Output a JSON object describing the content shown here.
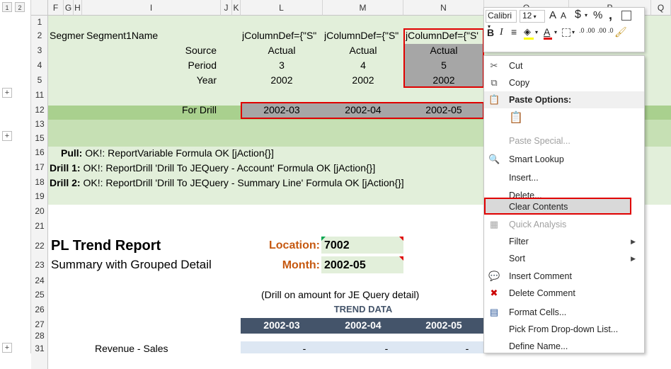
{
  "outline_levels": [
    "1",
    "2"
  ],
  "columns": [
    "F",
    "G",
    "H",
    "I",
    "J",
    "K",
    "L",
    "M",
    "N",
    "O",
    "P",
    "Q"
  ],
  "rows": [
    "1",
    "2",
    "3",
    "4",
    "5",
    "11",
    "12",
    "13",
    "15",
    "16",
    "17",
    "18",
    "19",
    "20",
    "21",
    "22",
    "23",
    "24",
    "25",
    "26",
    "27",
    "28",
    "31"
  ],
  "header_rows": {
    "r2": {
      "f": "Segmer",
      "g": "Segment1Name",
      "l": "jColumnDef={\"S\"",
      "m": "jColumnDef={\"S\"",
      "n": "jColumnDef={\"S'"
    },
    "r3": {
      "label": "Source",
      "l": "Actual",
      "m": "Actual",
      "n": "Actual"
    },
    "r4": {
      "label": "Period",
      "l": "3",
      "m": "4",
      "n": "5"
    },
    "r5": {
      "label": "Year",
      "l": "2002",
      "m": "2002",
      "n": "2002"
    },
    "r12": {
      "label": "For Drill",
      "l": "2002-03",
      "m": "2002-04",
      "n": "2002-05"
    }
  },
  "action_rows": [
    {
      "bold": "Pull:",
      "text": " OK!: ReportVariable Formula OK [jAction{}]"
    },
    {
      "bold": "Drill 1:",
      "text": " OK!: ReportDrill 'Drill To JEQuery - Account' Formula OK [jAction{}]"
    },
    {
      "bold": "Drill 2:",
      "text": " OK!: ReportDrill 'Drill To JEQuery - Summary Line' Formula OK [jAction{}]"
    }
  ],
  "report": {
    "title": "PL Trend Report",
    "subtitle": "Summary with Grouped Detail",
    "location_label": "Location:",
    "location_value": "7002",
    "month_label": "Month:",
    "month_value": "2002-05",
    "drill_note": "(Drill on amount for JE Query detail)",
    "trend_label": "TREND DATA",
    "trend_cols": [
      "2002-03",
      "2002-04",
      "2002-05"
    ],
    "row31_label": "Revenue - Sales",
    "row31_values": [
      "-",
      "-",
      "-"
    ]
  },
  "mini_toolbar": {
    "font_name": "Calibri",
    "font_size": "12",
    "grow": "A",
    "shrink": "A",
    "currency": "$",
    "percent": "%",
    "comma": ",",
    "bold": "B",
    "italic": "I",
    "inc_dec": ".0 .00",
    "dec_dec": ".00 .0"
  },
  "context_menu": {
    "items": [
      {
        "label": "Cut",
        "icon": "✂"
      },
      {
        "label": "Copy",
        "icon": "⧉"
      },
      {
        "label": "Paste Options:",
        "icon": "📋",
        "header": true
      },
      {
        "label": "",
        "icon": "📋"
      },
      {
        "label": "Paste Special...",
        "disabled": true
      },
      {
        "label": "Smart Lookup",
        "icon": "🔍"
      },
      {
        "label": "Insert..."
      },
      {
        "label": "Delete..."
      },
      {
        "label": "Clear Contents",
        "highlight": true
      },
      {
        "label": "Quick Analysis",
        "icon": "▦",
        "disabled": true
      },
      {
        "label": "Filter",
        "submenu": true
      },
      {
        "label": "Sort",
        "submenu": true
      },
      {
        "label": "Insert Comment",
        "icon": "💬"
      },
      {
        "label": "Delete Comment",
        "icon": "✖"
      },
      {
        "label": "Format Cells...",
        "icon": "▤"
      },
      {
        "label": "Pick From Drop-down List..."
      },
      {
        "label": "Define Name..."
      }
    ]
  },
  "colors": {
    "band": "#e2efda",
    "selection": "#a6a6a6",
    "red": "#e00000",
    "orange": "#c65911",
    "trend_header": "#44546a"
  }
}
